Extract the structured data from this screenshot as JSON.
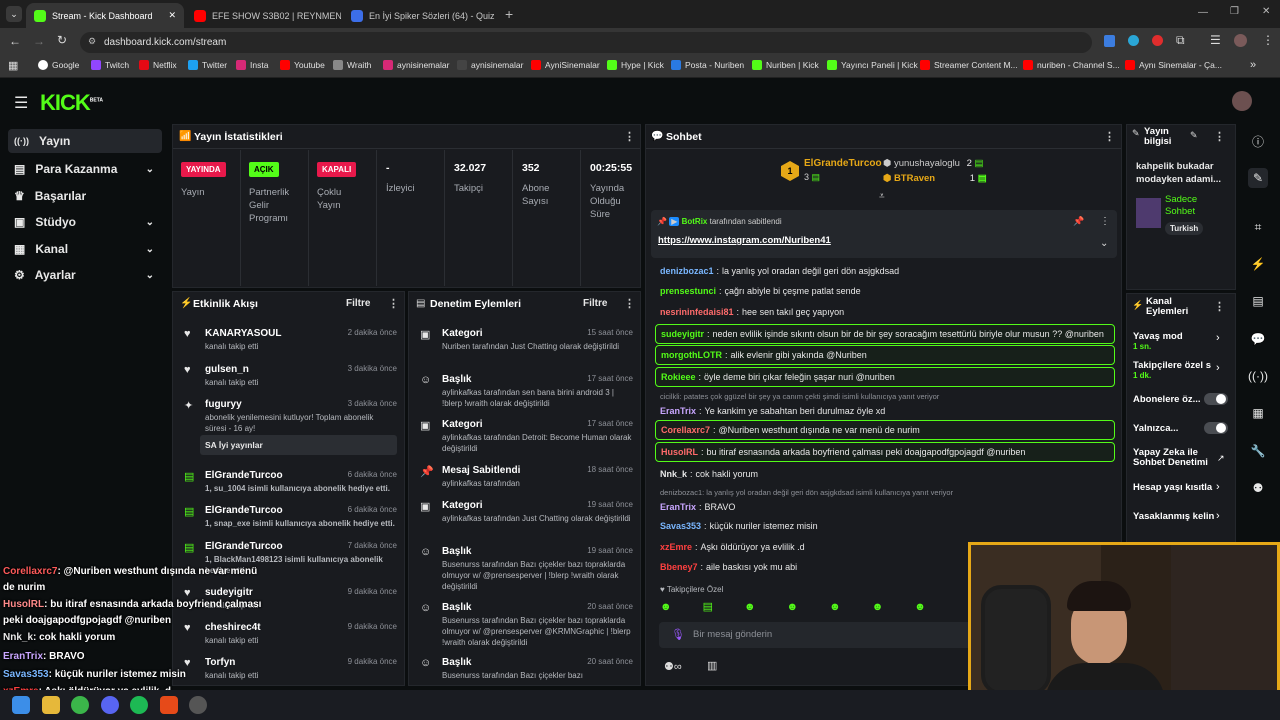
{
  "browser": {
    "tabs": [
      {
        "label": "Stream - Kick Dashboard"
      },
      {
        "label": "EFE SHOW S3B02 | REYNMEN -"
      },
      {
        "label": "En İyi Spiker Sözleri (64) - Quiz"
      }
    ],
    "url": "dashboard.kick.com/stream",
    "bookmarks": [
      "Google",
      "Twitch",
      "Netflix",
      "Twitter",
      "Insta",
      "Youtube",
      "Wraith",
      "aynisinemalar",
      "aynisinemalar",
      "AyniSinemalar",
      "Hype | Kick",
      "Posta - Nuriben",
      "Nuriben | Kick",
      "Yayıncı Paneli | Kick",
      "Streamer Content M...",
      "nuriben - Channel S...",
      "Aynı Sinemalar - Ça..."
    ]
  },
  "kick": {
    "logo": "KICK",
    "logo_beta": "BETA",
    "nav": [
      {
        "label": "Yayın"
      },
      {
        "label": "Para Kazanma"
      },
      {
        "label": "Başarılar"
      },
      {
        "label": "Stüdyo"
      },
      {
        "label": "Kanal"
      },
      {
        "label": "Ayarlar"
      }
    ]
  },
  "stats": {
    "title": "Yayın İstatistikleri",
    "badges": [
      {
        "label": "YAYINDA",
        "desc": "Yayın"
      },
      {
        "label": "AÇIK",
        "desc": "Partnerlik Gelir Programı"
      },
      {
        "label": "KAPALI",
        "desc": "Çoklu Yayın"
      }
    ],
    "values": [
      {
        "value": "-",
        "desc": "İzleyici"
      },
      {
        "value": "32.027",
        "desc": "Takipçi"
      },
      {
        "value": "352",
        "desc": "Abone Sayısı"
      },
      {
        "value": "00:25:55",
        "desc": "Yayında Olduğu Süre"
      }
    ]
  },
  "activity": {
    "title": "Etkinlik Akışı",
    "filter": "Filtre",
    "items": [
      {
        "name": "KANARYASOUL",
        "sub": "kanalı takip etti",
        "time": "2 dakika önce"
      },
      {
        "name": "gulsen_n",
        "sub": "kanalı takip etti",
        "time": "3 dakika önce"
      },
      {
        "name": "fuguryy",
        "sub": "abonelik yenilemesini kutluyor! Toplam abonelik süresi - 16 ay!",
        "time": "3 dakika önce",
        "msg": "SA İyi yayınlar"
      },
      {
        "name": "ElGrandeTurcoo",
        "sub": "1, su_1004 isimli kullanıcıya abonelik hediye etti.",
        "time": "6 dakika önce"
      },
      {
        "name": "ElGrandeTurcoo",
        "sub": "1, snap_exe isimli kullanıcıya abonelik hediye etti.",
        "time": "6 dakika önce"
      },
      {
        "name": "ElGrandeTurcoo",
        "sub": "1, BlackMan1498123 isimli kullanıcıya abonelik hediye etti.",
        "time": "7 dakika önce"
      },
      {
        "name": "sudeyigitr",
        "sub": "kanalı takip etti",
        "time": "9 dakika önce"
      },
      {
        "name": "cheshirec4t",
        "sub": "kanalı takip etti",
        "time": "9 dakika önce"
      },
      {
        "name": "Torfyn",
        "sub": "kanalı takip etti",
        "time": "9 dakika önce"
      }
    ]
  },
  "moderation": {
    "title": "Denetim Eylemleri",
    "filter": "Filtre",
    "items": [
      {
        "name": "Kategori",
        "sub": "Nuriben tarafından Just Chatting olarak değiştirildi",
        "time": "15 saat önce"
      },
      {
        "name": "Başlık",
        "sub": "aylinkafkas tarafından sen bana birini android 3 | !blerp !wraith olarak değiştirildi",
        "time": "17 saat önce"
      },
      {
        "name": "Kategori",
        "sub": "aylinkafkas tarafından Detroit: Become Human olarak değiştirildi",
        "time": "17 saat önce"
      },
      {
        "name": "Mesaj Sabitlendi",
        "sub": "aylinkafkas tarafından",
        "time": "18 saat önce"
      },
      {
        "name": "Kategori",
        "sub": "aylinkafkas tarafından Just Chatting olarak değiştirildi",
        "time": "19 saat önce"
      },
      {
        "name": "Başlık",
        "sub": "Busenurss tarafından Bazı çiçekler bazı topraklarda olmuyor w/ @prensesperver | !blerp !wraith olarak değiştirildi",
        "time": "19 saat önce"
      },
      {
        "name": "Başlık",
        "sub": "Busenurss tarafından Bazı çiçekler bazı topraklarda olmuyor w/ @prensesperver @KRMNGraphic | !blerp !wraith olarak değiştirildi",
        "time": "20 saat önce"
      },
      {
        "name": "Başlık",
        "sub": "Busenurss tarafından Bazı çiçekler bazı",
        "time": "20 saat önce"
      }
    ]
  },
  "chat": {
    "title": "Sohbet",
    "leaders": [
      {
        "name": "ElGrandeTurcoo",
        "count": "3",
        "rank": "1"
      },
      {
        "name": "yunushayaloglu",
        "count": "2"
      },
      {
        "name": "BTRaven",
        "count": "1"
      }
    ],
    "pinned_by": "BotRix",
    "pinned_by_suffix": "tarafından sabitlendi",
    "pinned_link": "https://www.instagram.com/Nuriben41",
    "messages": [
      {
        "user": "denizbozac1",
        "color": "#7ab7ff",
        "text": "la yanlış yol oradan değil geri dön asjgkdsad"
      },
      {
        "user": "prensestunci",
        "color": "#53fc18",
        "text": "çağrı abiyle bi çeşme patlat sende"
      },
      {
        "user": "nesrininfedaisi81",
        "color": "#ff6b6b",
        "text": "hee sen takıl geç yapıyon"
      },
      {
        "user": "sudeyigitr",
        "color": "#53fc18",
        "text": "neden evlilik işinde sıkıntı olsun bir de bir şey soracağım tesettürlü biriyle olur musun ?? @nuriben",
        "hl": true
      },
      {
        "user": "morgothLOTR",
        "color": "#53fc18",
        "text": "alik evlenir gibi yakında @Nuriben",
        "hl": true
      },
      {
        "user": "Rokieee",
        "color": "#53fc18",
        "text": "öyle deme biri çıkar feleğin şaşar nuri @nuriben",
        "hl": true
      },
      {
        "user": "EranTrix",
        "color": "#c9a6ff",
        "text": "Ye kankim ye sabahtan beri durulmaz öyle xd",
        "reply": "cicilkli: patates çok ggüzel bir şey ya canım çekti şimdi isimli kullanıcıya yanıt veriyor"
      },
      {
        "user": "Corellaxrc7",
        "color": "#ff6b6b",
        "text": "@Nuriben westhunt dışında ne var menü de nurim",
        "hl": true
      },
      {
        "user": "HusolRL",
        "color": "#ff6b6b",
        "text": "bu itiraf esnasında arkada boyfriend çalması peki doajgapodfgpojagdf @nuriben",
        "hl": true
      },
      {
        "user": "Nnk_k",
        "color": "#e8e8e8",
        "text": "cok hakli yorum"
      },
      {
        "user": "EranTrix",
        "color": "#c9a6ff",
        "text": "BRAVO",
        "reply": "denizbozac1: la yanlış yol oradan değil geri dön asjgkdsad isimli kullanıcıya yanıt veriyor"
      },
      {
        "user": "Savas353",
        "color": "#7ab7ff",
        "text": "küçük nuriler istemez misin"
      },
      {
        "user": "xzEmre",
        "color": "#ff4040",
        "text": "Aşkı öldürüyor ya evlilik .d"
      },
      {
        "user": "Bbeney7",
        "color": "#ff4040",
        "text": "aile baskısı yok mu abi"
      }
    ],
    "followers_only": "Takipçilere Özel",
    "input_placeholder": "Bir mesaj gönderin"
  },
  "stream_info": {
    "title": "Yayın bilgisi",
    "text": "kahpelik bukadar modayken adami...",
    "category": "Sadece Sohbet",
    "tag": "Turkish"
  },
  "channel_actions": {
    "title": "Kanal Eylemleri",
    "items": [
      {
        "label": "Yavaş mod",
        "sub": "1 sn."
      },
      {
        "label": "Takipçilere özel s",
        "sub": "1 dk."
      },
      {
        "label": "Abonelere öz..."
      },
      {
        "label": "Yalnızca..."
      },
      {
        "label": "Yapay Zeka ile Sohbet Denetimi"
      },
      {
        "label": "Hesap yaşı kısıtla"
      },
      {
        "label": "Yasaklanmış kelin"
      }
    ]
  },
  "overlay_chat": [
    {
      "user": "Corellaxrc7",
      "color": "#ff5a5a",
      "text": ": @Nuriben westhunt dışında ne var menü"
    },
    {
      "user": "",
      "color": "#fff",
      "text": "de nurim"
    },
    {
      "user": "HusolRL",
      "color": "#ff8a8a",
      "text": ": bu itiraf esnasında arkada boyfriend çalması"
    },
    {
      "user": "",
      "color": "#fff",
      "text": "peki doajgapodfgpojagdf @nuriben"
    },
    {
      "user": "Nnk_k",
      "color": "#e8e8e8",
      "text": ": cok hakli yorum"
    },
    {
      "user": "EranTrix",
      "color": "#c9a6ff",
      "text": ": BRAVO"
    },
    {
      "user": "Savas353",
      "color": "#7ab7ff",
      "text": ": küçük nuriler istemez misin"
    },
    {
      "user": "xzEmre",
      "color": "#ff4040",
      "text": ": Aşkı öldürüyor ya evlilik .d"
    }
  ],
  "colors": {
    "accent": "#53fc18",
    "bg": "#0b0e0f",
    "panel": "#191b1f",
    "stream_border": "#e6a817"
  }
}
